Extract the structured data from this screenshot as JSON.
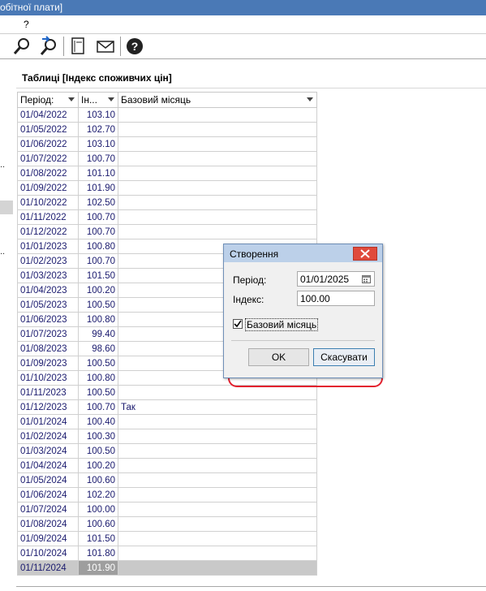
{
  "window": {
    "title_fragment": "обітної плати]"
  },
  "menu": {
    "items": [
      "?"
    ]
  },
  "toolbar": {
    "icons": [
      "find-icon",
      "find-next-icon",
      "report-icon",
      "mail-icon",
      "help-icon"
    ]
  },
  "left_strip": {
    "dots": [
      "..",
      ".."
    ]
  },
  "panel": {
    "title": "Таблиці [Індекс споживчих цін]"
  },
  "table": {
    "columns": [
      "Період:",
      "Ін...",
      "Базовий місяць"
    ],
    "rows": [
      {
        "period": "01/04/2022",
        "index": "103.10",
        "base": ""
      },
      {
        "period": "01/05/2022",
        "index": "102.70",
        "base": ""
      },
      {
        "period": "01/06/2022",
        "index": "103.10",
        "base": ""
      },
      {
        "period": "01/07/2022",
        "index": "100.70",
        "base": ""
      },
      {
        "period": "01/08/2022",
        "index": "101.10",
        "base": ""
      },
      {
        "period": "01/09/2022",
        "index": "101.90",
        "base": ""
      },
      {
        "period": "01/10/2022",
        "index": "102.50",
        "base": ""
      },
      {
        "period": "01/11/2022",
        "index": "100.70",
        "base": ""
      },
      {
        "period": "01/12/2022",
        "index": "100.70",
        "base": ""
      },
      {
        "period": "01/01/2023",
        "index": "100.80",
        "base": ""
      },
      {
        "period": "01/02/2023",
        "index": "100.70",
        "base": ""
      },
      {
        "period": "01/03/2023",
        "index": "101.50",
        "base": ""
      },
      {
        "period": "01/04/2023",
        "index": "100.20",
        "base": ""
      },
      {
        "period": "01/05/2023",
        "index": "100.50",
        "base": ""
      },
      {
        "period": "01/06/2023",
        "index": "100.80",
        "base": ""
      },
      {
        "period": "01/07/2023",
        "index": "99.40",
        "base": ""
      },
      {
        "period": "01/08/2023",
        "index": "98.60",
        "base": ""
      },
      {
        "period": "01/09/2023",
        "index": "100.50",
        "base": ""
      },
      {
        "period": "01/10/2023",
        "index": "100.80",
        "base": ""
      },
      {
        "period": "01/11/2023",
        "index": "100.50",
        "base": ""
      },
      {
        "period": "01/12/2023",
        "index": "100.70",
        "base": "Так"
      },
      {
        "period": "01/01/2024",
        "index": "100.40",
        "base": ""
      },
      {
        "period": "01/02/2024",
        "index": "100.30",
        "base": ""
      },
      {
        "period": "01/03/2024",
        "index": "100.50",
        "base": ""
      },
      {
        "period": "01/04/2024",
        "index": "100.20",
        "base": ""
      },
      {
        "period": "01/05/2024",
        "index": "100.60",
        "base": ""
      },
      {
        "period": "01/06/2024",
        "index": "102.20",
        "base": ""
      },
      {
        "period": "01/07/2024",
        "index": "100.00",
        "base": ""
      },
      {
        "period": "01/08/2024",
        "index": "100.60",
        "base": ""
      },
      {
        "period": "01/09/2024",
        "index": "101.50",
        "base": ""
      },
      {
        "period": "01/10/2024",
        "index": "101.80",
        "base": ""
      },
      {
        "period": "01/11/2024",
        "index": "101.90",
        "base": "",
        "selected": true
      }
    ]
  },
  "dialog": {
    "title": "Створення",
    "period_label": "Період:",
    "period_value": "01/01/2025",
    "index_label": "Індекс:",
    "index_value": "100.00",
    "base_month_label": "Базовий місяць",
    "base_month_checked": true,
    "ok_label": "OK",
    "cancel_label": "Скасувати"
  },
  "colors": {
    "titlebar": "#4a79b6",
    "highlight": "#e3202e",
    "close_button": "#e04a3c",
    "cell_text": "#1a1a6e",
    "selected_row": "#c9c9c9"
  }
}
